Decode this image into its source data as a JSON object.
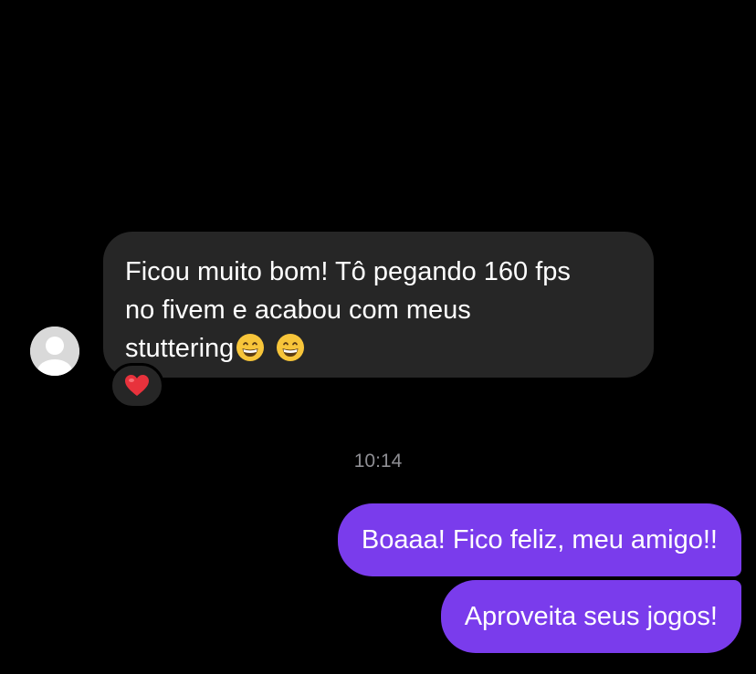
{
  "incoming_message": {
    "lines": [
      "Ficou muito bom! Tô pegando 160 fps",
      "no fivem e acabou com meus",
      "stuttering"
    ],
    "emojis": [
      "grinning-face-with-smiling-eyes",
      "grinning-face-with-smiling-eyes"
    ],
    "reaction": "red-heart",
    "bubble_color": "#262626"
  },
  "avatar": {
    "icon": "default-profile-icon"
  },
  "timestamp": "10:14",
  "outgoing_messages": [
    {
      "text": "Boaaa! Fico feliz, meu amigo!!"
    },
    {
      "text": "Aproveita seus jogos!"
    }
  ],
  "colors": {
    "background": "#000000",
    "outgoing_bubble": "#7a3cec",
    "timestamp": "#8e8e93"
  }
}
